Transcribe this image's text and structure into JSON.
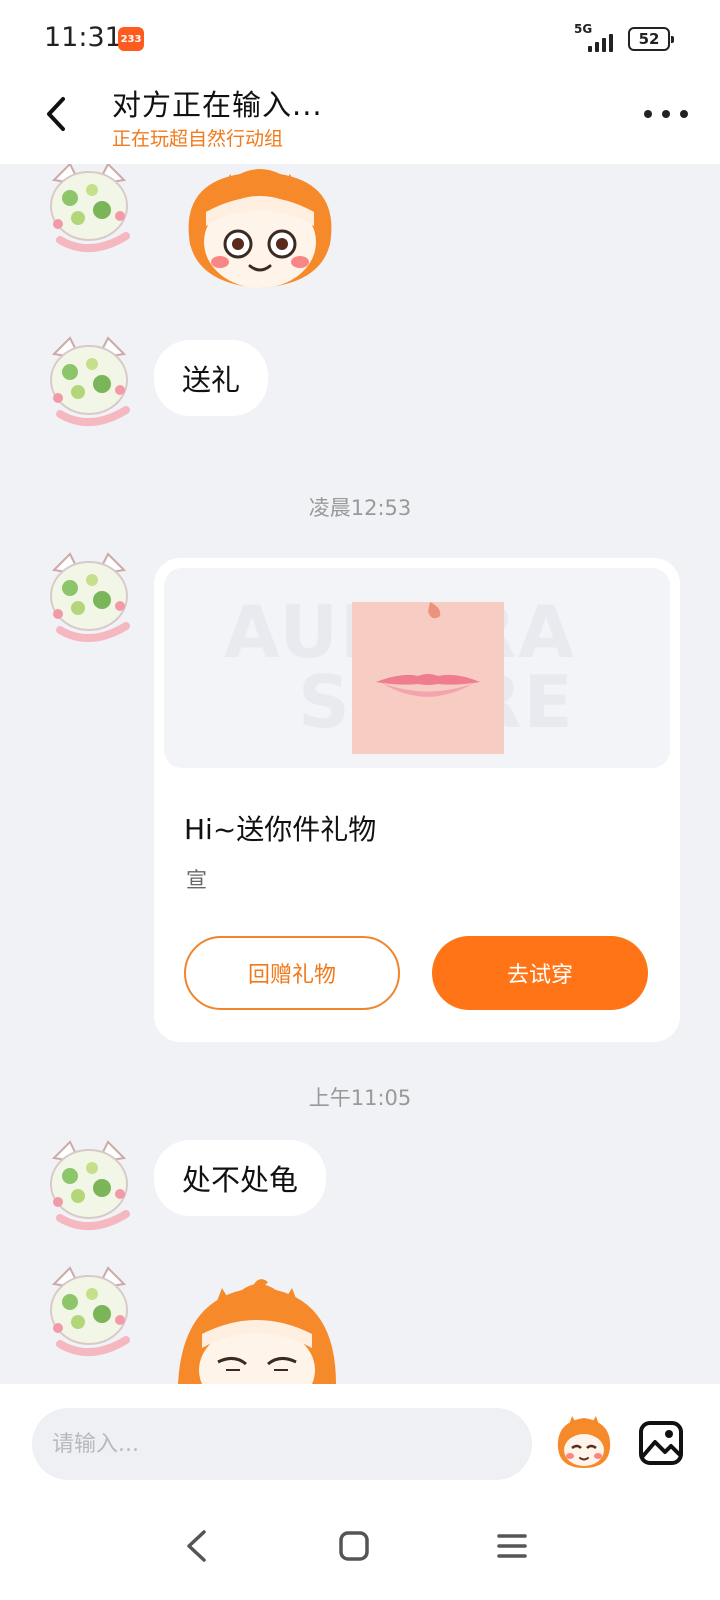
{
  "status_bar": {
    "time": "11:31",
    "notification_badge": "233",
    "network": "5G",
    "battery": "52"
  },
  "header": {
    "title": "对方正在输入...",
    "subtitle": "正在玩超自然行动组"
  },
  "messages": {
    "msg1": "送礼",
    "timestamp1": "凌晨12:53",
    "gift_card": {
      "title": "Hi~送你件礼物",
      "sender": "宣",
      "return_label": "回赠礼物",
      "try_label": "去试穿",
      "banner_watermark_1": "AURORA",
      "banner_watermark_2": "STORE"
    },
    "timestamp2": "上午11:05",
    "msg2": "处不处龟"
  },
  "input": {
    "placeholder": "请输入..."
  },
  "colors": {
    "accent": "#ff7416",
    "subtitle": "#f07a1c",
    "background": "#f1f2f6"
  },
  "icons": {
    "back": "chevron-left-icon",
    "more": "more-dots-icon",
    "emoji": "emoji-sticker-icon",
    "image": "image-icon",
    "nav_back": "nav-back-icon",
    "nav_home": "nav-home-icon",
    "nav_menu": "nav-menu-icon"
  }
}
